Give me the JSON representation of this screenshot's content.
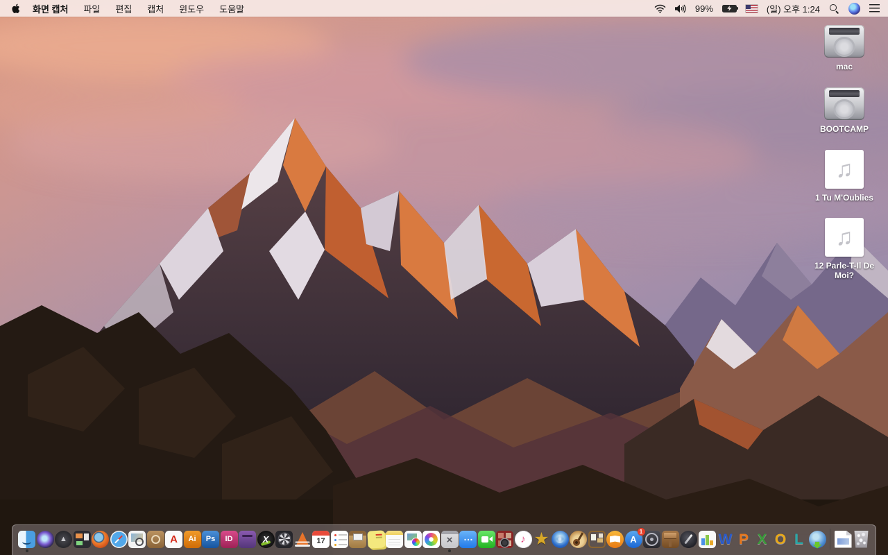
{
  "menu_bar": {
    "menus": [
      {
        "name": "app-menu-screen-capture",
        "label": "화면 캡처"
      },
      {
        "name": "menu-file",
        "label": "파일"
      },
      {
        "name": "menu-edit",
        "label": "편집"
      },
      {
        "name": "menu-capture",
        "label": "캡처"
      },
      {
        "name": "menu-window",
        "label": "윈도우"
      },
      {
        "name": "menu-help",
        "label": "도움말"
      }
    ],
    "status": {
      "battery_percent": "99%",
      "clock": "(일) 오후 1:24",
      "icons": [
        "wifi-icon",
        "volume-icon",
        "battery-charging-icon",
        "us-flag-icon",
        "spotlight-search-icon",
        "siri-icon",
        "notification-center-icon"
      ]
    }
  },
  "desktop": {
    "icons": [
      {
        "name": "desktop-icon-mac",
        "kind": "drive",
        "label": "mac"
      },
      {
        "name": "desktop-icon-bootcamp",
        "kind": "drive",
        "label": "BOOTCAMP"
      },
      {
        "name": "desktop-icon-tu-m-oublies",
        "kind": "audio",
        "label": "1 Tu M'Oublies"
      },
      {
        "name": "desktop-icon-parle-t-il-de-moi",
        "kind": "audio",
        "label": "12 Parle-T-Il De Moi?"
      }
    ]
  },
  "dock": {
    "items": [
      {
        "name": "finder-icon",
        "kind": "finder",
        "running": true
      },
      {
        "name": "siri-dock-icon",
        "kind": "siri"
      },
      {
        "name": "launchpad-icon",
        "kind": "launchpad",
        "glyph": "▲"
      },
      {
        "name": "mission-control-icon",
        "kind": "mission"
      },
      {
        "name": "firefox-icon",
        "kind": "firefox"
      },
      {
        "name": "safari-icon",
        "kind": "safari"
      },
      {
        "name": "preview-icon",
        "kind": "preview"
      },
      {
        "name": "contacts-book-icon",
        "kind": "contacts"
      },
      {
        "name": "acrobat-reader-icon",
        "kind": "acrobat",
        "glyph": "A"
      },
      {
        "name": "illustrator-icon",
        "kind": "ai",
        "glyph": "Ai"
      },
      {
        "name": "photoshop-icon",
        "kind": "ps",
        "glyph": "Ps"
      },
      {
        "name": "indesign-icon",
        "kind": "id",
        "glyph": "ID"
      },
      {
        "name": "toast-titanium-icon",
        "kind": "toast"
      },
      {
        "name": "media-converter-x-icon",
        "kind": "xconv",
        "glyph": "X"
      },
      {
        "name": "film-reel-utility-icon",
        "kind": "reel"
      },
      {
        "name": "vlc-icon",
        "kind": "vlc"
      },
      {
        "name": "calendar-icon",
        "kind": "calendar",
        "glyph": "17"
      },
      {
        "name": "reminders-icon",
        "kind": "reminders"
      },
      {
        "name": "stuffit-expander-icon",
        "kind": "stuffit"
      },
      {
        "name": "stickies-icon",
        "kind": "stickies"
      },
      {
        "name": "notes-icon",
        "kind": "notes"
      },
      {
        "name": "colorsync-utility-icon",
        "kind": "colorsync"
      },
      {
        "name": "photos-icon",
        "kind": "photos"
      },
      {
        "name": "screen-capture-app-icon",
        "kind": "capture",
        "glyph": "×",
        "running": true
      },
      {
        "name": "messages-icon",
        "kind": "messages",
        "glyph": "…"
      },
      {
        "name": "facetime-icon",
        "kind": "facetime"
      },
      {
        "name": "photo-booth-icon",
        "kind": "photobooth"
      },
      {
        "name": "itunes-icon",
        "kind": "itunes",
        "glyph": "♪"
      },
      {
        "name": "imovie-classic-icon",
        "kind": "imovie",
        "glyph": "★"
      },
      {
        "name": "dvd-media-player-icon",
        "kind": "dvdapp"
      },
      {
        "name": "garageband-icon",
        "kind": "garageband"
      },
      {
        "name": "corkboard-app-icon",
        "kind": "corkboard"
      },
      {
        "name": "ibooks-icon",
        "kind": "ibooks"
      },
      {
        "name": "app-store-icon",
        "kind": "appstore",
        "glyph": "A",
        "badge": "1"
      },
      {
        "name": "helm-wheel-utility-icon",
        "kind": "dial"
      },
      {
        "name": "keynote-classic-icon",
        "kind": "keynote"
      },
      {
        "name": "pages-classic-icon",
        "kind": "pages09"
      },
      {
        "name": "numbers-classic-icon",
        "kind": "numbers09"
      },
      {
        "name": "ms-word-icon",
        "kind": "word",
        "glyph": "W"
      },
      {
        "name": "ms-powerpoint-icon",
        "kind": "ppt",
        "glyph": "P"
      },
      {
        "name": "ms-excel-icon",
        "kind": "excel",
        "glyph": "X"
      },
      {
        "name": "ms-outlook-icon",
        "kind": "outlook",
        "glyph": "O"
      },
      {
        "name": "ms-lync-icon",
        "kind": "lync",
        "glyph": "L"
      },
      {
        "name": "web-downloader-icon",
        "kind": "globedl"
      },
      {
        "name": "dock-divider",
        "kind": "divider"
      },
      {
        "name": "document-file-icon",
        "kind": "docfile"
      },
      {
        "name": "trash-full-icon",
        "kind": "trash"
      }
    ]
  },
  "colors": {
    "app_store_badge": "#e8402a",
    "menubar_tint": "#f6e9e7"
  }
}
